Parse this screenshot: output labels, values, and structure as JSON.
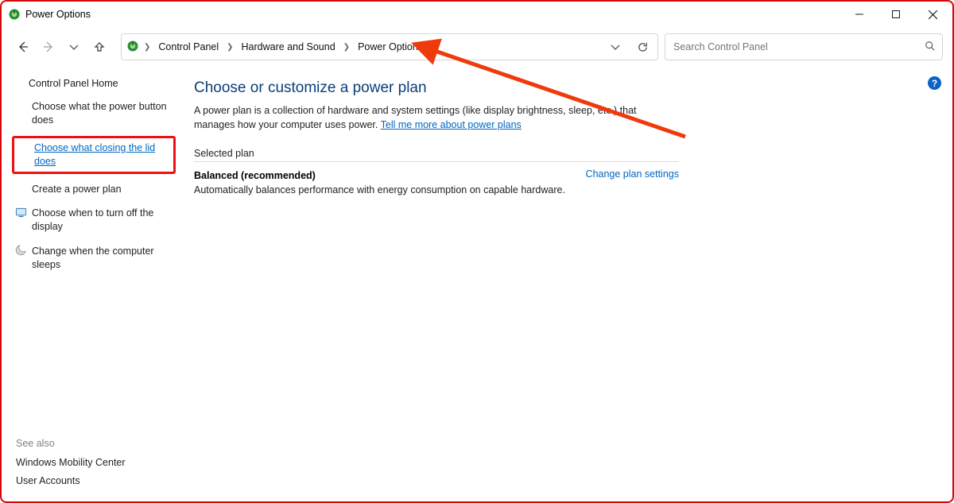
{
  "window_title": "Power Options",
  "breadcrumb": [
    "Control Panel",
    "Hardware and Sound",
    "Power Options"
  ],
  "search_placeholder": "Search Control Panel",
  "sidebar": {
    "home": "Control Panel Home",
    "links": [
      "Choose what the power button does",
      "Choose what closing the lid does",
      "Create a power plan",
      "Choose when to turn off the display",
      "Change when the computer sleeps"
    ]
  },
  "see_also": {
    "header": "See also",
    "items": [
      "Windows Mobility Center",
      "User Accounts"
    ]
  },
  "main": {
    "title": "Choose or customize a power plan",
    "description_before": "A power plan is a collection of hardware and system settings (like display brightness, sleep, etc.) that manages how your computer uses power. ",
    "description_link": "Tell me more about power plans",
    "selected_plan_label": "Selected plan",
    "plan_name": "Balanced (recommended)",
    "plan_desc": "Automatically balances performance with energy consumption on capable hardware.",
    "change_link": "Change plan settings"
  },
  "help_badge": "?"
}
